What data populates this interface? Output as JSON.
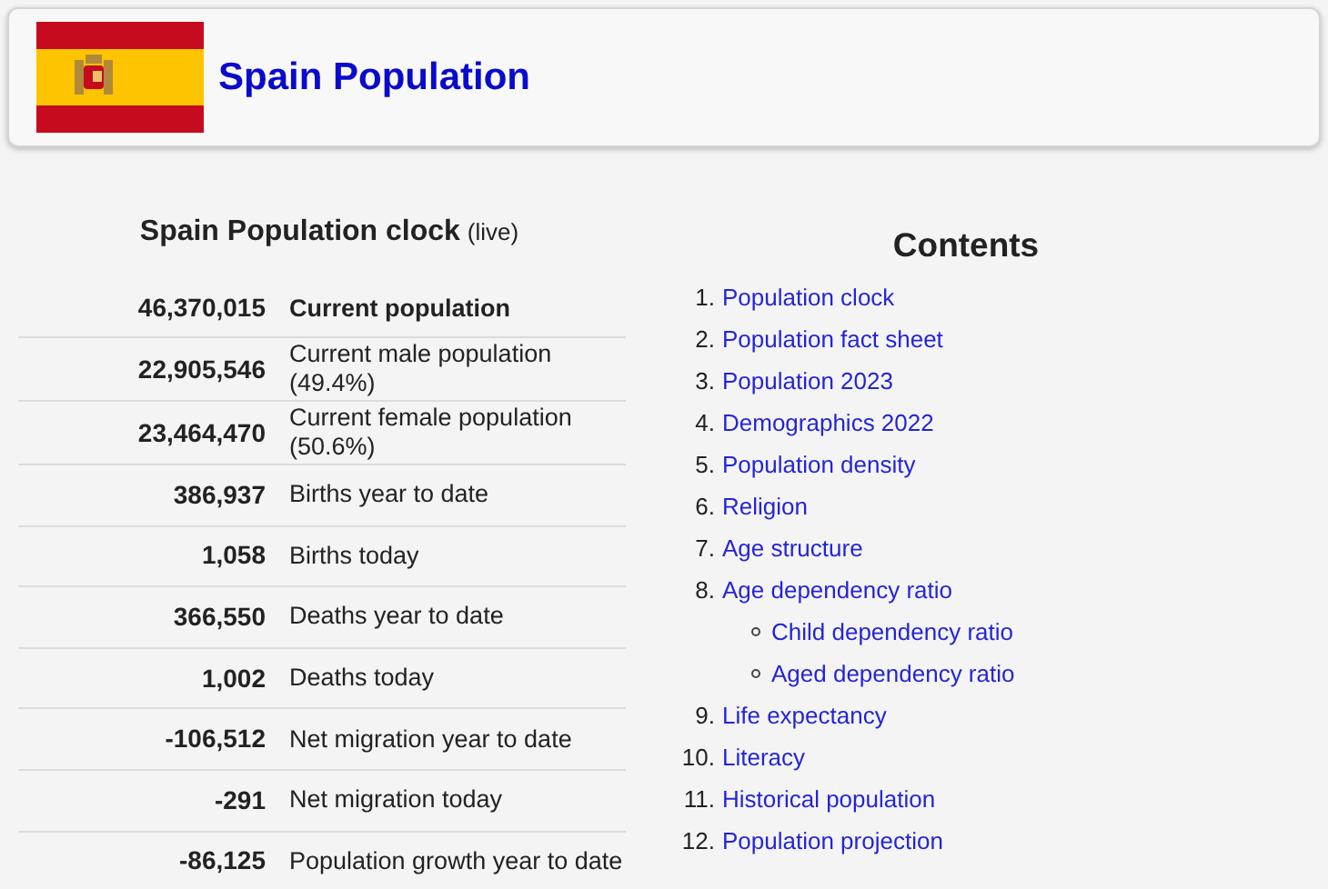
{
  "header": {
    "title": "Spain Population"
  },
  "clock": {
    "title": "Spain Population clock",
    "note": "(live)",
    "rows": [
      {
        "value": "46,370,015",
        "label": "Current population",
        "emphasis": true
      },
      {
        "value": "22,905,546",
        "label": "Current male population (49.4%)",
        "emphasis": false
      },
      {
        "value": "23,464,470",
        "label": "Current female population (50.6%)",
        "emphasis": false
      },
      {
        "value": "386,937",
        "label": "Births year to date",
        "emphasis": false
      },
      {
        "value": "1,058",
        "label": "Births today",
        "emphasis": false
      },
      {
        "value": "366,550",
        "label": "Deaths year to date",
        "emphasis": false
      },
      {
        "value": "1,002",
        "label": "Deaths today",
        "emphasis": false
      },
      {
        "value": "-106,512",
        "label": "Net migration year to date",
        "emphasis": false
      },
      {
        "value": "-291",
        "label": "Net migration today",
        "emphasis": false
      },
      {
        "value": "-86,125",
        "label": "Population growth year to date",
        "emphasis": false
      }
    ]
  },
  "contents": {
    "title": "Contents",
    "items": [
      {
        "number": "1.",
        "label": "Population clock"
      },
      {
        "number": "2.",
        "label": "Population fact sheet"
      },
      {
        "number": "3.",
        "label": "Population 2023"
      },
      {
        "number": "4.",
        "label": "Demographics 2022"
      },
      {
        "number": "5.",
        "label": "Population density"
      },
      {
        "number": "6.",
        "label": "Religion"
      },
      {
        "number": "7.",
        "label": "Age structure"
      },
      {
        "number": "8.",
        "label": "Age dependency ratio",
        "children": [
          {
            "label": "Child dependency ratio"
          },
          {
            "label": "Aged dependency ratio"
          }
        ]
      },
      {
        "number": "9.",
        "label": "Life expectancy"
      },
      {
        "number": "10.",
        "label": "Literacy"
      },
      {
        "number": "11.",
        "label": "Historical population"
      },
      {
        "number": "12.",
        "label": "Population projection"
      }
    ]
  }
}
